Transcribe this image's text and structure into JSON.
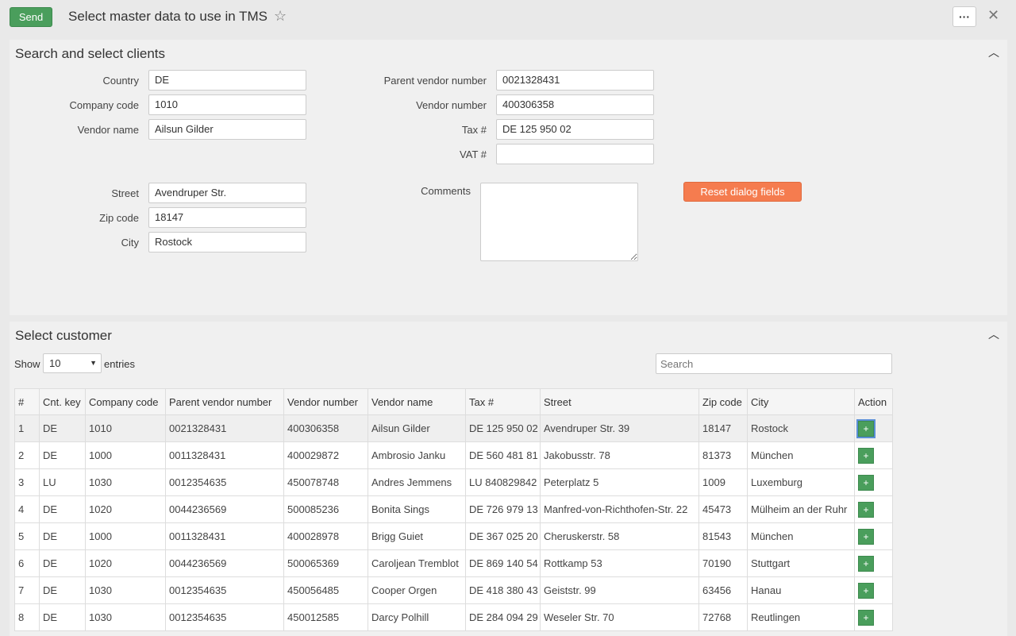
{
  "header": {
    "send_label": "Send",
    "title": "Select master data to use in TMS",
    "more_label": "···",
    "close_label": "✕"
  },
  "search_panel": {
    "title": "Search and select clients",
    "fields": {
      "country": {
        "label": "Country",
        "value": "DE"
      },
      "company_code": {
        "label": "Company code",
        "value": "1010"
      },
      "vendor_name": {
        "label": "Vendor name",
        "value": "Ailsun Gilder"
      },
      "parent_vendor_number": {
        "label": "Parent vendor number",
        "value": "0021328431"
      },
      "vendor_number": {
        "label": "Vendor number",
        "value": "400306358"
      },
      "tax": {
        "label": "Tax #",
        "value": "DE 125 950 02"
      },
      "vat": {
        "label": "VAT #",
        "value": ""
      },
      "street": {
        "label": "Street",
        "value": "Avendruper Str."
      },
      "zip_code": {
        "label": "Zip code",
        "value": "18147"
      },
      "city": {
        "label": "City",
        "value": "Rostock"
      },
      "comments": {
        "label": "Comments",
        "value": ""
      }
    },
    "reset_label": "Reset dialog fields"
  },
  "customer_panel": {
    "title": "Select customer",
    "show_label": "Show",
    "entries_value": "10",
    "entries_label": "entries",
    "search_placeholder": "Search",
    "columns": [
      "#",
      "Cnt. key",
      "Company code",
      "Parent vendor number",
      "Vendor number",
      "Vendor name",
      "Tax #",
      "Street",
      "Zip code",
      "City",
      "Action"
    ],
    "rows": [
      [
        "1",
        "DE",
        "1010",
        "0021328431",
        "400306358",
        "Ailsun Gilder",
        "DE 125 950 02",
        "Avendruper Str. 39",
        "18147",
        "Rostock"
      ],
      [
        "2",
        "DE",
        "1000",
        "0011328431",
        "400029872",
        "Ambrosio Janku",
        "DE 560 481 81",
        "Jakobusstr. 78",
        "81373",
        "München"
      ],
      [
        "3",
        "LU",
        "1030",
        "0012354635",
        "450078748",
        "Andres Jemmens",
        "LU 840829842",
        "Peterplatz 5",
        "1009",
        "Luxemburg"
      ],
      [
        "4",
        "DE",
        "1020",
        "0044236569",
        "500085236",
        "Bonita Sings",
        "DE 726 979 13",
        "Manfred-von-Richthofen-Str. 22",
        "45473",
        "Mülheim an der Ruhr"
      ],
      [
        "5",
        "DE",
        "1000",
        "0011328431",
        "400028978",
        "Brigg Guiet",
        "DE 367 025 20",
        "Cheruskerstr. 58",
        "81543",
        "München"
      ],
      [
        "6",
        "DE",
        "1020",
        "0044236569",
        "500065369",
        "Caroljean Tremblot",
        "DE 869 140 54",
        "Rottkamp 53",
        "70190",
        "Stuttgart"
      ],
      [
        "7",
        "DE",
        "1030",
        "0012354635",
        "450056485",
        "Cooper Orgen",
        "DE 418 380 43",
        "Geiststr. 99",
        "63456",
        "Hanau"
      ],
      [
        "8",
        "DE",
        "1030",
        "0012354635",
        "450012585",
        "Darcy Polhill",
        "DE 284 094 29",
        "Weseler Str. 70",
        "72768",
        "Reutlingen"
      ]
    ],
    "action_label": "+"
  }
}
